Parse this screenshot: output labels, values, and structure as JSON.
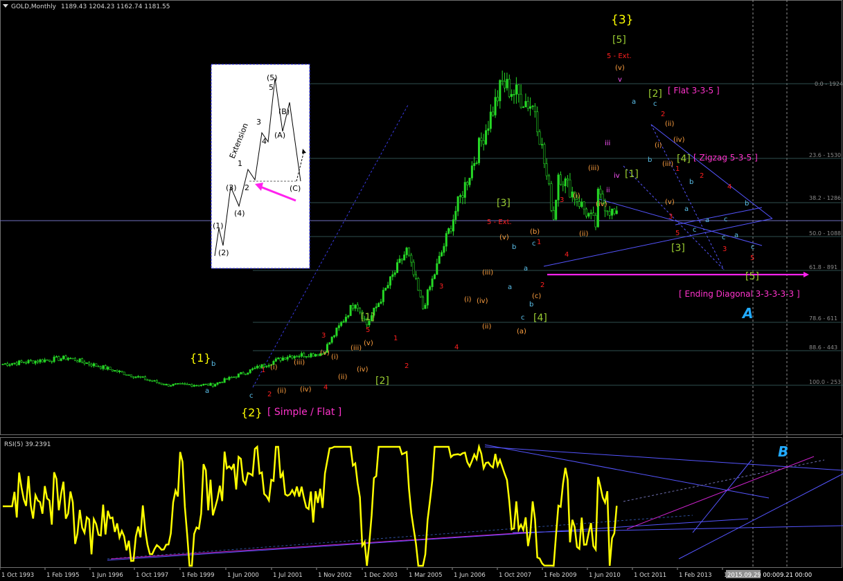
{
  "header": {
    "symbol": "GOLD,Monthly",
    "ohlc": "1189.43 1204.23 1162.74 1181.55"
  },
  "indicator": {
    "label": "RSI(5) 39.2391"
  },
  "colors": {
    "background": "#000000",
    "candle": "#26d926",
    "rsi": "#ffff00",
    "fib_line": "#2f4f4f",
    "wave_primary": "#ffff00",
    "wave_intermediate": "#9acd32",
    "wave_minor": "#ff2020",
    "wave_minute": "#ffa040",
    "wave_minuette": "#5bc0eb",
    "annotation_pink": "#ff33cc",
    "trend_blue": "#5555ff"
  },
  "x_axis_labels": [
    "1 Oct 1993",
    "1 Feb 1995",
    "1 Jun 1996",
    "1 Oct 1997",
    "1 Feb 1999",
    "1 Jun 2000",
    "1 Jul 2001",
    "1 Nov 2002",
    "1 Dec 2003",
    "1 Mar 2005",
    "1 Jun 2006",
    "1 Oct 2007",
    "1 Feb 2009",
    "1 Jun 2010",
    "1 Oct 2011",
    "1 Feb 2013",
    "1 Jun"
  ],
  "x_axis_cursor": "2015.09.29 00:00",
  "x_axis_cursor_value": "9.21 00:00",
  "fib_levels": [
    {
      "label": "0.0 - 1924"
    },
    {
      "label": "23.6 - 1530"
    },
    {
      "label": "38.2 - 1286"
    },
    {
      "label": "50.0 - 1088"
    },
    {
      "label": "61.8 - 891"
    },
    {
      "label": "78.6 - 611"
    },
    {
      "label": "88.6 - 443"
    },
    {
      "label": "100.0 - 253"
    }
  ],
  "annotations": {
    "primary_1": "{1}",
    "primary_2": "{2}",
    "primary_3": "{3}",
    "simple_flat": "[ Simple / Flat ]",
    "int_1a": "[1]",
    "int_2a": "[2]",
    "int_3a": "[3]",
    "int_4a": "[4]",
    "int_5": "[5]",
    "ext5_a": "5 - Ext.",
    "ext5_b": "5 - Ext.",
    "int_2b": "[2]",
    "flat335": "[ Flat 3-3-5 ]",
    "int_4b": "[4]",
    "zigzag": "[ Zigzag 5-3-5 ]",
    "int_1b": "[1]",
    "int_3b": "[3]",
    "int_5b": "[5]",
    "ending_diag": "[ Ending Diagonal 3-3-3-3-3 ]",
    "marker_a": "A",
    "marker_b": "B"
  },
  "inset": {
    "label_extension": "Extension",
    "labels": [
      "(1)",
      "(2)",
      "(3)",
      "(4)",
      "(5)",
      "1",
      "2",
      "3",
      "4",
      "5",
      "(A)",
      "(B)",
      "(C)"
    ]
  },
  "chart_data": {
    "type": "candlestick",
    "title": "GOLD,Monthly",
    "x_start": "1993-10",
    "x_end": "2015-09",
    "y_axis": "price (USD)",
    "price_anchors": [
      {
        "date": "1993-10",
        "price": 370
      },
      {
        "date": "1996-02",
        "price": 405
      },
      {
        "date": "1999-08",
        "price": 255
      },
      {
        "date": "2001-04",
        "price": 256
      },
      {
        "date": "2002-06",
        "price": 325
      },
      {
        "date": "2003-12",
        "price": 415
      },
      {
        "date": "2005-03",
        "price": 430
      },
      {
        "date": "2006-05",
        "price": 720
      },
      {
        "date": "2006-10",
        "price": 590
      },
      {
        "date": "2008-03",
        "price": 1000
      },
      {
        "date": "2008-10",
        "price": 680
      },
      {
        "date": "2009-12",
        "price": 1220
      },
      {
        "date": "2011-08",
        "price": 1924
      },
      {
        "date": "2012-10",
        "price": 1790
      },
      {
        "date": "2013-06",
        "price": 1180
      },
      {
        "date": "2013-08",
        "price": 1430
      },
      {
        "date": "2014-12",
        "price": 1140
      },
      {
        "date": "2015-01",
        "price": 1300
      },
      {
        "date": "2015-09",
        "price": 1181.55
      }
    ],
    "rsi_period": 5,
    "rsi_last": 39.2391
  }
}
